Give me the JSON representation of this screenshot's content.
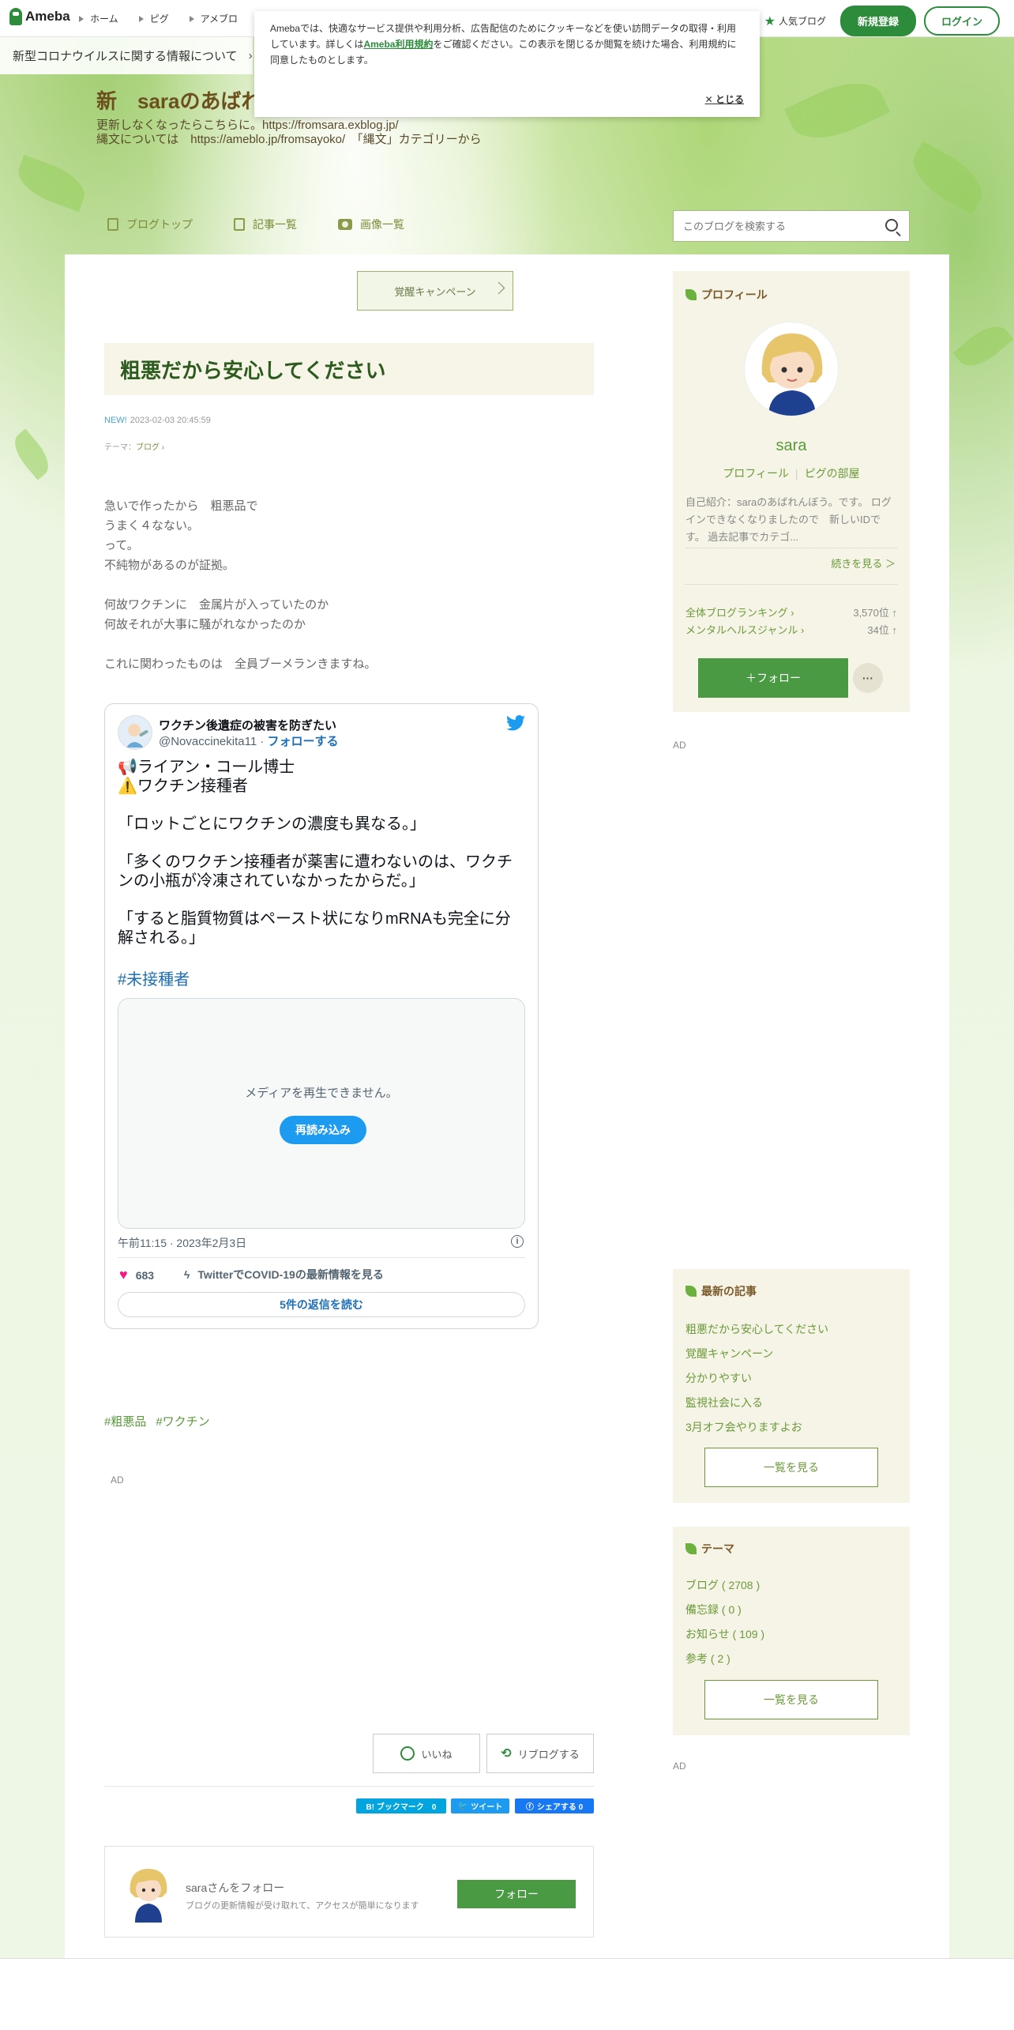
{
  "header": {
    "logo_text": "Ameba",
    "nav": [
      "ホーム",
      "ピグ",
      "アメブロ"
    ],
    "popular_label": "人気ブログ",
    "signup_label": "新規登録",
    "login_label": "ログイン"
  },
  "covid_banner": {
    "text": "新型コロナウイルスに関する情報について"
  },
  "cookie": {
    "text_before": "Amebaでは、快適なサービス提供や利用分析、広告配信のためにクッキーなどを使い訪問データの取得・利用しています。詳しくは",
    "link": "Ameba利用規約",
    "text_after": "をご確認ください。この表示を閉じるか閲覧を続けた場合、利用規約に同意したものとします。",
    "close_label": "とじる"
  },
  "blog": {
    "title": "新　saraのあばれ",
    "desc_line1": "更新しなくなったらこちらに。https://fromsara.exblog.jp/",
    "desc_line2": "縄文については　https://ameblo.jp/fromsayoko/　「縄文」カテゴリーから",
    "nav": [
      "ブログトップ",
      "記事一覧",
      "画像一覧"
    ],
    "search_placeholder": "このブログを検索する"
  },
  "entry": {
    "campaign_label": "覚醒キャンペーン",
    "title": "粗悪だから安心してください",
    "new_badge": "NEW!",
    "datetime": "2023-02-03 20:45:59",
    "theme_label": "テーマ：",
    "theme_value": "ブログ",
    "body_lines": [
      "急いで作ったから　粗悪品で",
      "うまく４なない。",
      "って。",
      "不純物があるのが証拠。",
      "",
      "何故ワクチンに　金属片が入っていたのか",
      "何故それが大事に騒がれなかったのか",
      "",
      "これに関わったものは　全員ブーメランきますね。"
    ],
    "hashtags": [
      "#粗悪品",
      "#ワクチン"
    ],
    "ad_label": "AD",
    "iine_label": "いいね",
    "reblog_label": "リブログする",
    "share": {
      "hatena": "B! ブックマーク　0",
      "tweet": "ツイート",
      "facebook": "シェアする 0"
    },
    "follow_box": {
      "title": "saraさんをフォロー",
      "sub": "ブログの更新情報が受け取れて、アクセスが簡単になります",
      "button": "フォロー"
    }
  },
  "tweet": {
    "name": "ワクチン後遺症の被害を防ぎたい",
    "handle": "@Novaccinekita11",
    "dot": " · ",
    "follow": "フォローする",
    "text": "📢ライアン・コール博士\n⚠️ワクチン接種者\n\n「ロットごとにワクチンの濃度も異なる。」\n\n「多くのワクチン接種者が薬害に遭わないのは、ワクチンの小瓶が冷凍されていなかったからだ。」\n\n「すると脂質物質はペースト状になりmRNAも完全に分解される。」",
    "hashtag": "#未接種者",
    "media_msg": "メディアを再生できません。",
    "reload": "再読み込み",
    "time": "午前11:15 · 2023年2月3日",
    "likes": "683",
    "covid_link": "TwitterでCOVID-19の最新情報を見る",
    "replies": "5件の返信を読む"
  },
  "sidebar": {
    "profile": {
      "heading": "プロフィール",
      "name": "sara",
      "link1": "プロフィール",
      "link2": "ピグの部屋",
      "intro": "自己紹介：saraのあばれんぼう。です。 ログインできなくなりましたので　新しいIDです。 過去記事でカテゴ...",
      "more": "続きを見る ＞",
      "ranking": [
        {
          "label": "全体ブログランキング",
          "value": "3,570位 ↑"
        },
        {
          "label": "メンタルヘルスジャンル",
          "value": "34位 ↑"
        }
      ],
      "follow": "＋フォロー",
      "more_dots": "···"
    },
    "ad_label": "AD",
    "recent": {
      "heading": "最新の記事",
      "items": [
        "粗悪だから安心してください",
        "覚醒キャンペーン",
        "分かりやすい",
        "監視社会に入る",
        "3月オフ会やりますよお"
      ],
      "button": "一覧を見る"
    },
    "theme": {
      "heading": "テーマ",
      "items": [
        "ブログ ( 2708 )",
        "備忘録 ( 0 )",
        "お知らせ ( 109 )",
        "参考 ( 2 )"
      ],
      "button": "一覧を見る"
    }
  },
  "colors": {
    "accent": "#2d8c3c",
    "twitter": "#1d9bf0",
    "hatena": "#00a4de",
    "facebook": "#1877f2"
  }
}
